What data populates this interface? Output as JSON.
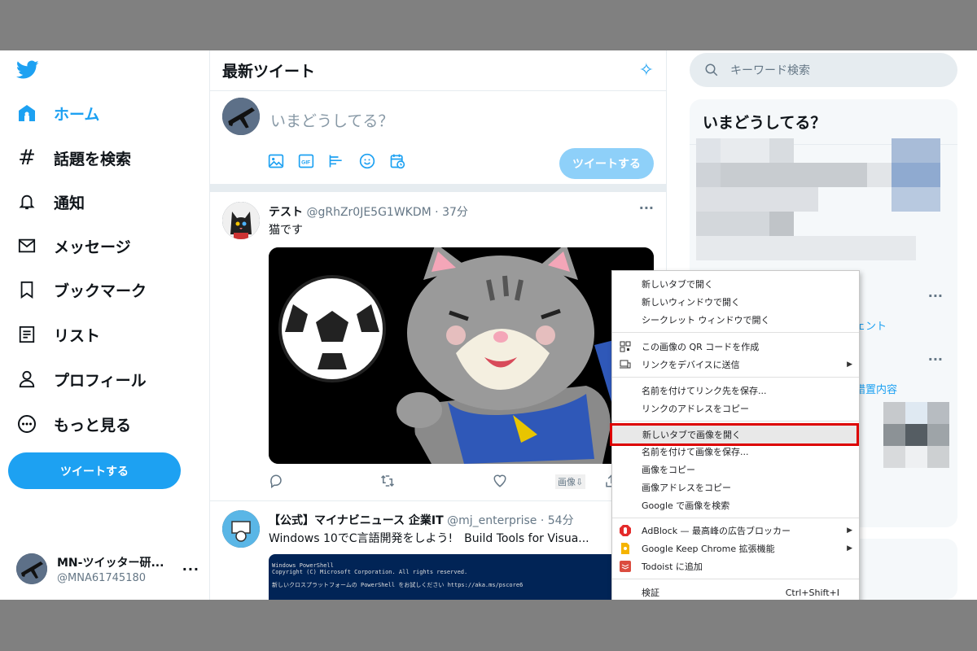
{
  "nav": {
    "items": [
      {
        "label": "ホーム",
        "icon": "home-icon"
      },
      {
        "label": "話題を検索",
        "icon": "hashtag-icon"
      },
      {
        "label": "通知",
        "icon": "bell-icon"
      },
      {
        "label": "メッセージ",
        "icon": "envelope-icon"
      },
      {
        "label": "ブックマーク",
        "icon": "bookmark-icon"
      },
      {
        "label": "リスト",
        "icon": "list-icon"
      },
      {
        "label": "プロフィール",
        "icon": "person-icon"
      },
      {
        "label": "もっと見る",
        "icon": "more-circle-icon"
      }
    ],
    "tweet_button": "ツイートする"
  },
  "account": {
    "name": "MN-ツイッター研...",
    "handle": "@MNA61745180",
    "more": "···"
  },
  "timeline": {
    "title": "最新ツイート",
    "compose_placeholder": "いまどうしてる？",
    "compose_button": "ツイートする",
    "tweets": [
      {
        "name": "テスト",
        "handle": "@gRhZr0JE5G1WKDM",
        "time": "· 37分",
        "text": "猫です",
        "dots": "···",
        "media_tag": "画像⇩"
      },
      {
        "name": "【公式】マイナビニュース 企業IT",
        "handle": "@mj_enterprise",
        "time": "· 54分",
        "text": "Windows 10でC言語開発をしよう!　Build Tools for Visua..."
      }
    ],
    "ps_lines": [
      "Windows PowerShell",
      "Copyright (C) Microsoft Corporation. All rights reserved.",
      "新しいクロスプラットフォームの PowerShell をお試しください https://aka.ms/pscore6"
    ]
  },
  "right": {
    "search_placeholder": "キーワード検索",
    "trends_title": "いまどうしてる？",
    "frag1": "ェント",
    "frag2": "措置内容",
    "dots": "···"
  },
  "context_menu": {
    "items": [
      "新しいタブで開く",
      "新しいウィンドウで開く",
      "シークレット ウィンドウで開く",
      "この画像の QR コードを作成",
      "リンクをデバイスに送信",
      "名前を付けてリンク先を保存...",
      "リンクのアドレスをコピー",
      "新しいタブで画像を開く",
      "名前を付けて画像を保存...",
      "画像をコピー",
      "画像アドレスをコピー",
      "Google で画像を検索",
      "AdBlock — 最高峰の広告ブロッカー",
      "Google Keep Chrome 拡張機能",
      "Todoist に追加",
      "検証"
    ],
    "shortcut": "Ctrl+Shift+I",
    "highlight_color": "#dd0000"
  }
}
